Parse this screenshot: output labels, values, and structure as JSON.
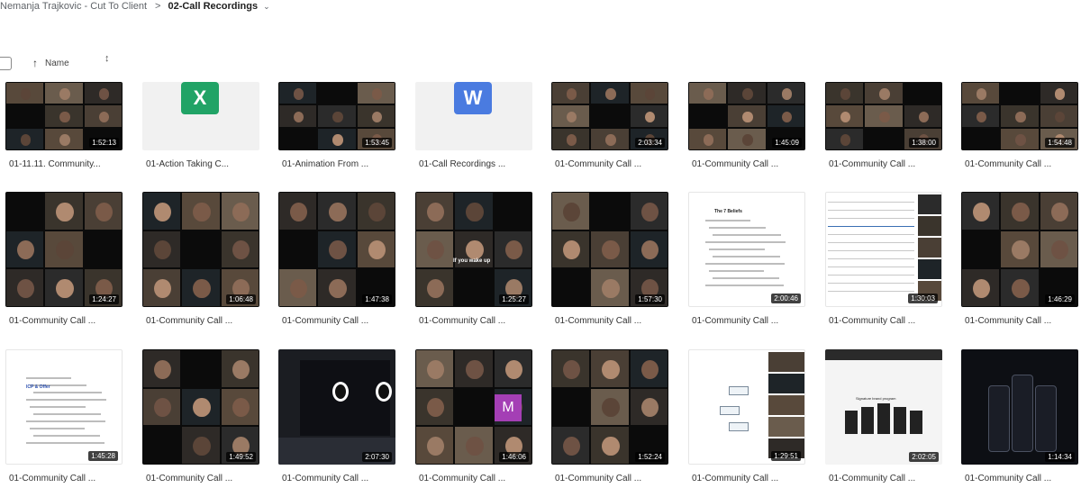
{
  "breadcrumb": {
    "parent": "Nemanja Trajkovic - Cut To Client",
    "separator": ">",
    "current": "02-Call Recordings",
    "chevron": "⌄"
  },
  "sort": {
    "label": "Name",
    "arrow": "↑",
    "toggle": "↕"
  },
  "files": [
    {
      "label": "01-11.11. Community...",
      "duration": "1:52:13",
      "kind": "video"
    },
    {
      "label": "01-Action Taking C...",
      "duration": "",
      "kind": "excel",
      "icon_letter": "X",
      "icon_color": "#21a366"
    },
    {
      "label": "01-Animation From ...",
      "duration": "1:53:45",
      "kind": "video"
    },
    {
      "label": "01-Call Recordings ...",
      "duration": "",
      "kind": "word",
      "icon_letter": "W",
      "icon_color": "#4a7be0"
    },
    {
      "label": "01-Community Call ...",
      "duration": "2:03:34",
      "kind": "video"
    },
    {
      "label": "01-Community Call ...",
      "duration": "1:45:09",
      "kind": "video"
    },
    {
      "label": "01-Community Call ...",
      "duration": "1:38:00",
      "kind": "video"
    },
    {
      "label": "01-Community Call ...",
      "duration": "1:54:48",
      "kind": "video"
    },
    {
      "label": "01-Community Call ...",
      "duration": "1:24:27",
      "kind": "video"
    },
    {
      "label": "01-Community Call ...",
      "duration": "1:06:48",
      "kind": "video"
    },
    {
      "label": "01-Community Call ...",
      "duration": "1:47:38",
      "kind": "video"
    },
    {
      "label": "01-Community Call ...",
      "duration": "1:25:27",
      "kind": "video",
      "caption": "If you wake up"
    },
    {
      "label": "01-Community Call ...",
      "duration": "1:57:30",
      "kind": "video"
    },
    {
      "label": "01-Community Call ...",
      "duration": "2:00:46",
      "kind": "doc",
      "caption": "The 7 Beliefs"
    },
    {
      "label": "01-Community Call ...",
      "duration": "1:30:03",
      "kind": "sheet"
    },
    {
      "label": "01-Community Call ...",
      "duration": "1:46:29",
      "kind": "video"
    },
    {
      "label": "01-Community Call ...",
      "duration": "1:45:28",
      "kind": "doc2",
      "caption": "ICP & Offer"
    },
    {
      "label": "01-Community Call ...",
      "duration": "1:49:52",
      "kind": "video"
    },
    {
      "label": "01-Community Call ...",
      "duration": "2:07:30",
      "kind": "editor"
    },
    {
      "label": "01-Community Call ...",
      "duration": "1:46:06",
      "kind": "video",
      "icon_letter": "M",
      "icon_color": "#a43fb5"
    },
    {
      "label": "01-Community Call ...",
      "duration": "1:52:24",
      "kind": "video"
    },
    {
      "label": "01-Community Call ...",
      "duration": "1:29:51",
      "kind": "diagram"
    },
    {
      "label": "01-Community Call ...",
      "duration": "2:02:05",
      "kind": "flow",
      "caption": "Signature brand program"
    },
    {
      "label": "01-Community Call ...",
      "duration": "1:14:34",
      "kind": "phones"
    }
  ],
  "colors": {
    "dark_thumb": "#0b0b0b",
    "duration_bg": "rgba(0,0,0,0.75)",
    "label_text": "#333333"
  }
}
